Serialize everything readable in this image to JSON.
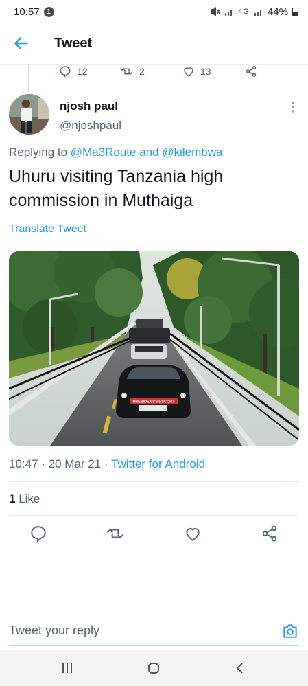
{
  "status_bar": {
    "time": "10:57",
    "notification_count": "1",
    "network": "4G",
    "battery": "44%"
  },
  "header": {
    "title": "Tweet",
    "back_icon": "arrow-left-icon"
  },
  "previous_tweet_actions": {
    "replies": "12",
    "retweets": "2",
    "likes": "13"
  },
  "tweet": {
    "author_name": "njosh paul",
    "author_handle": "@njoshpaul",
    "replying_prefix": "Replying to",
    "reply_to_1": "@Ma3Route",
    "reply_and": "and",
    "reply_to_2": "@kilembwa",
    "text": "Uhuru visiting Tanzania high commission in Muthaiga",
    "translate_label": "Translate Tweet",
    "photo_plate": "PRESIDENT'S ESCORT",
    "time": "10:47",
    "date": "20 Mar 21",
    "source": "Twitter for Android",
    "like_count": "1",
    "like_label": "Like"
  },
  "reply_bar": {
    "placeholder": "Tweet your reply"
  },
  "colors": {
    "accent": "#1d9bf0",
    "text_primary": "#14171a",
    "text_secondary": "#536471"
  }
}
